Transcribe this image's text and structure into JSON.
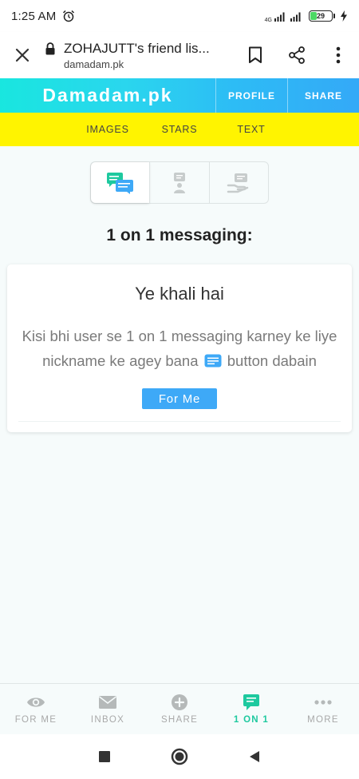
{
  "status_bar": {
    "time": "1:25 AM",
    "network": "4G",
    "battery": "29",
    "battery_level": 0.29
  },
  "browser": {
    "page_title": "ZOHAJUTT's friend lis...",
    "domain": "damadam.pk",
    "icons": [
      "close-icon",
      "lock-icon",
      "bookmark-icon",
      "share-icon",
      "more-vert-icon"
    ]
  },
  "site_header": {
    "logo": "Damadam.pk",
    "profile_label": "PROFILE",
    "share_label": "SHARE"
  },
  "sub_nav": {
    "items": [
      "IMAGES",
      "STARS",
      "TEXT"
    ]
  },
  "segment_control": {
    "selected_index": 0,
    "icons": [
      "chat-bubbles-icon",
      "mic-user-icon",
      "hand-message-icon"
    ],
    "accent_color": "#1ec99f"
  },
  "main": {
    "heading": "1 on 1 messaging:",
    "card": {
      "title": "Ye khali hai",
      "body_part1": "Kisi bhi user se 1 on 1 messaging karney ke liye nickname ke agey bana",
      "body_part2": "button dabain",
      "button_label": "For Me"
    }
  },
  "tab_bar": {
    "active_index": 3,
    "tabs": [
      {
        "label": "FOR ME",
        "icon": "eye-icon"
      },
      {
        "label": "INBOX",
        "icon": "envelope-icon"
      },
      {
        "label": "SHARE",
        "icon": "plus-circle-icon"
      },
      {
        "label": "1 ON 1",
        "icon": "message-icon"
      },
      {
        "label": "MORE",
        "icon": "more-horiz-icon"
      }
    ]
  },
  "colors": {
    "header_gradient_start": "#19e6df",
    "header_gradient_end": "#34a9f7",
    "sub_nav_bg": "#fff400",
    "button_blue": "#3ea9f7",
    "active_tab": "#1ec99f"
  }
}
